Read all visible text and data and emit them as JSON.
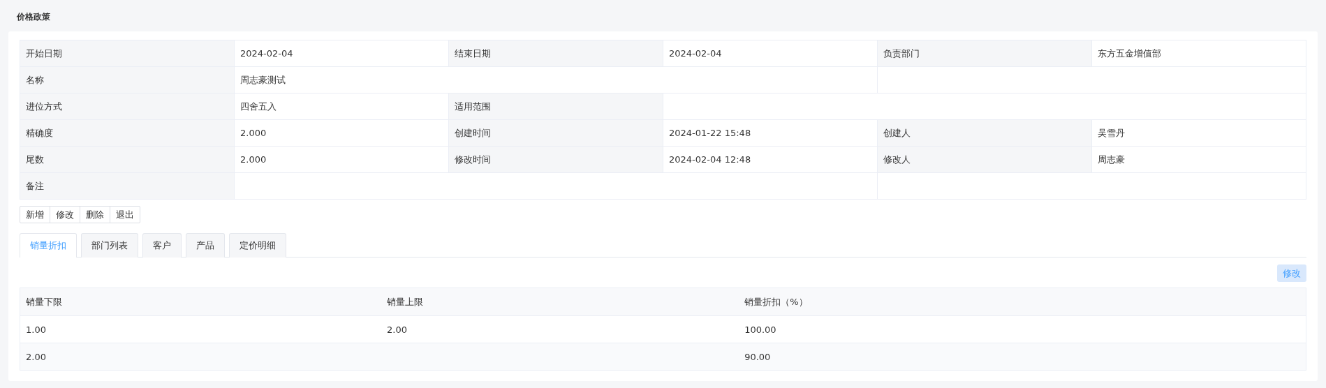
{
  "page_title": "价格政策",
  "details": [
    [
      {
        "kind": "label",
        "text": "开始日期"
      },
      {
        "kind": "value",
        "text": "2024-02-04"
      },
      {
        "kind": "label",
        "text": "结束日期"
      },
      {
        "kind": "value",
        "text": "2024-02-04"
      },
      {
        "kind": "label",
        "text": "负责部门"
      },
      {
        "kind": "value",
        "text": "东方五金增值部"
      }
    ],
    [
      {
        "kind": "label",
        "text": "名称"
      },
      {
        "kind": "wide",
        "text": "周志豪测试"
      },
      {
        "kind": "value"
      }
    ],
    [
      {
        "kind": "label",
        "text": "进位方式"
      },
      {
        "kind": "value",
        "text": "四舍五入"
      },
      {
        "kind": "label",
        "text": "适用范围"
      },
      {
        "kind": "value"
      }
    ],
    [
      {
        "kind": "label",
        "text": "精确度"
      },
      {
        "kind": "value",
        "text": "2.000"
      },
      {
        "kind": "label",
        "text": "创建时间"
      },
      {
        "kind": "value",
        "text": "2024-01-22 15:48"
      },
      {
        "kind": "label",
        "text": "创建人"
      },
      {
        "kind": "value",
        "text": "吴雪丹"
      }
    ],
    [
      {
        "kind": "label",
        "text": "尾数"
      },
      {
        "kind": "value",
        "text": "2.000"
      },
      {
        "kind": "label",
        "text": "修改时间"
      },
      {
        "kind": "value",
        "text": "2024-02-04 12:48"
      },
      {
        "kind": "label",
        "text": "修改人"
      },
      {
        "kind": "value",
        "text": "周志豪"
      }
    ],
    [
      {
        "kind": "label",
        "text": "备注"
      },
      {
        "kind": "wide"
      },
      {
        "kind": "value"
      }
    ]
  ],
  "actions": [
    "新增",
    "修改",
    "删除",
    "退出"
  ],
  "tabs": [
    {
      "label": "销量折扣",
      "selected": true
    },
    {
      "label": "部门列表",
      "selected": false
    },
    {
      "label": "客户",
      "selected": false
    },
    {
      "label": "产品",
      "selected": false
    },
    {
      "label": "定价明细",
      "selected": false
    }
  ],
  "edit_button": "修改",
  "table": {
    "columns": [
      "销量下限",
      "销量上限",
      "销量折扣（%）"
    ],
    "rows": [
      [
        "1.00",
        "2.00",
        "100.00"
      ],
      [
        "2.00",
        "",
        "90.00"
      ]
    ]
  }
}
